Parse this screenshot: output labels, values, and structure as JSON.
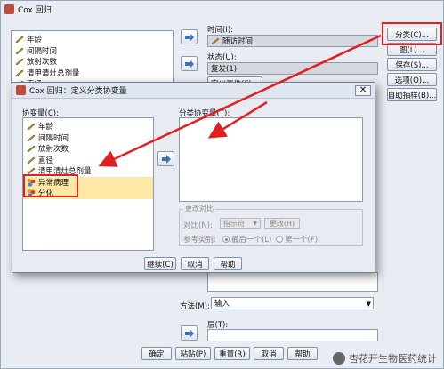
{
  "main_window": {
    "title": "Cox 回归",
    "variables": [
      {
        "label": "年龄",
        "icon": "ruler"
      },
      {
        "label": "间隔时间",
        "icon": "ruler"
      },
      {
        "label": "放射次数",
        "icon": "ruler"
      },
      {
        "label": "清甲清灶总剂量",
        "icon": "ruler"
      },
      {
        "label": "直径",
        "icon": "ruler"
      }
    ],
    "time_label": "时间(I):",
    "time_value": "随访时间",
    "status_label": "状态(U):",
    "status_value": "复发(1)",
    "define_event_label": "定义事件(F)...",
    "method_label": "方法(M):",
    "method_value": "输入",
    "layer_label": "层(T):",
    "right_buttons": [
      "分类(C)...",
      "图(L)...",
      "保存(S)...",
      "选项(O)...",
      "自助抽样(B)..."
    ],
    "bottom_buttons": [
      "确定",
      "粘贴(P)",
      "重置(R)",
      "取消",
      "帮助"
    ]
  },
  "dialog": {
    "title": "Cox 回归：定义分类协变量",
    "covariates_label": "协变量(C):",
    "covariates": [
      {
        "label": "年龄",
        "icon": "ruler",
        "highlight": false
      },
      {
        "label": "间隔时间",
        "icon": "ruler",
        "highlight": false
      },
      {
        "label": "放射次数",
        "icon": "ruler",
        "highlight": false
      },
      {
        "label": "直径",
        "icon": "ruler",
        "highlight": false
      },
      {
        "label": "清甲清灶总剂量",
        "icon": "ruler",
        "highlight": false
      },
      {
        "label": "异常病理",
        "icon": "nominal",
        "highlight": true
      },
      {
        "label": "分化",
        "icon": "nominal",
        "highlight": true
      }
    ],
    "categorical_label": "分类协变量(T):",
    "change_contrast": {
      "group_title": "更改对比",
      "contrast_label": "对比(N):",
      "contrast_value": "指示符",
      "change_button": "更改(H)",
      "reference_label": "参考类别:",
      "last_label": "最后一个(L)",
      "first_label": "第一个(F)"
    },
    "buttons": [
      "继续(C)",
      "取消",
      "帮助"
    ]
  },
  "colors": {
    "highlight_box": "#e02020",
    "arrow": "#e02020",
    "nominal_highlight": "#ffe8a6"
  },
  "watermark": "杏花开生物医药统计"
}
